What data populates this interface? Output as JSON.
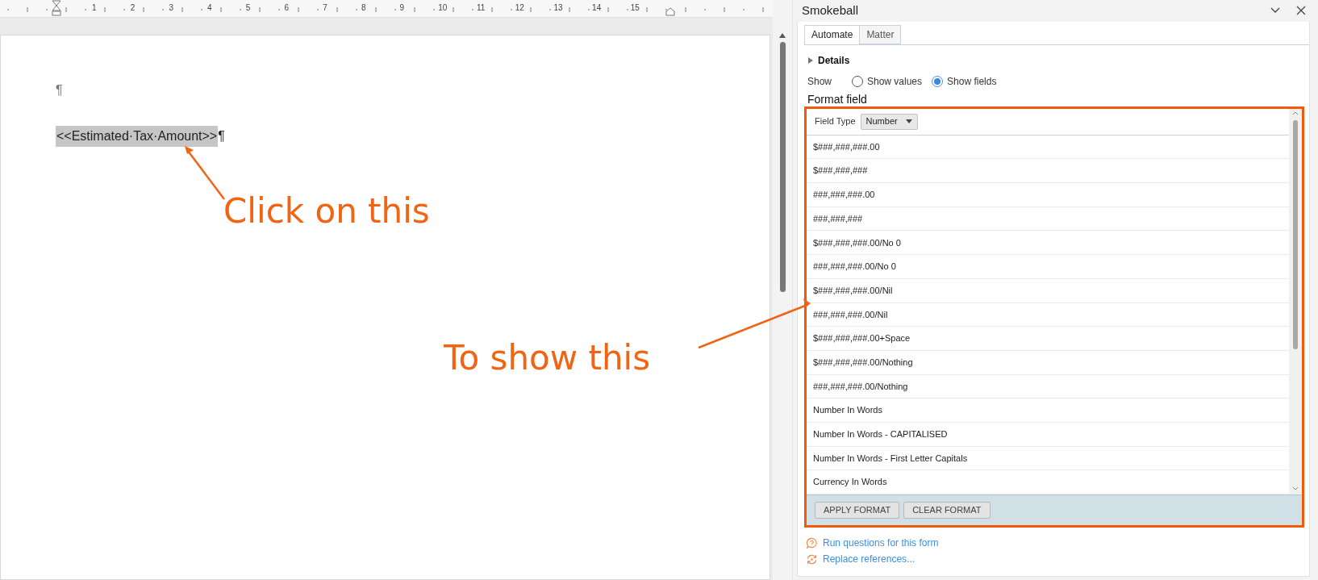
{
  "ruler": {
    "numbers": [
      "1",
      "2",
      "3",
      "4",
      "5",
      "6",
      "7",
      "8",
      "9",
      "10",
      "11",
      "12",
      "13",
      "14",
      "15"
    ]
  },
  "document": {
    "paragraphs": [
      {
        "kind": "empty",
        "mark": "¶"
      },
      {
        "kind": "field",
        "field": "<<Estimated·Tax·Amount>>",
        "mark": "¶"
      }
    ]
  },
  "annotations": [
    {
      "text": "Click on this"
    },
    {
      "text": "To show this"
    }
  ],
  "pane": {
    "title": "Smokeball",
    "tabs": [
      {
        "label": "Automate",
        "selected": true
      },
      {
        "label": "Matter",
        "selected": false
      }
    ],
    "details": {
      "label": "Details",
      "expanded": false
    },
    "show": {
      "label": "Show",
      "options": [
        {
          "label": "Show values",
          "selected": false
        },
        {
          "label": "Show fields",
          "selected": true
        }
      ]
    },
    "format_field": {
      "title": "Format field",
      "field_type_label": "Field Type",
      "field_type_value": "Number",
      "formats": [
        "$###,###,###.00",
        "$###,###,###",
        "###,###,###.00",
        "###,###,###",
        "$###,###,###.00/No 0",
        "###,###,###.00/No 0",
        "$###,###,###.00/Nil",
        "###,###,###.00/Nil",
        "$###,###,###.00+Space",
        "$###,###,###.00/Nothing",
        "###,###,###.00/Nothing",
        "Number In Words",
        "Number In Words - CAPITALISED",
        "Number In Words - First Letter Capitals",
        "Currency In Words"
      ],
      "buttons": [
        "APPLY FORMAT",
        "CLEAR FORMAT"
      ]
    },
    "links": [
      {
        "kind": "question",
        "label": "Run questions for this form"
      },
      {
        "kind": "replace",
        "label": "Replace references..."
      }
    ]
  }
}
